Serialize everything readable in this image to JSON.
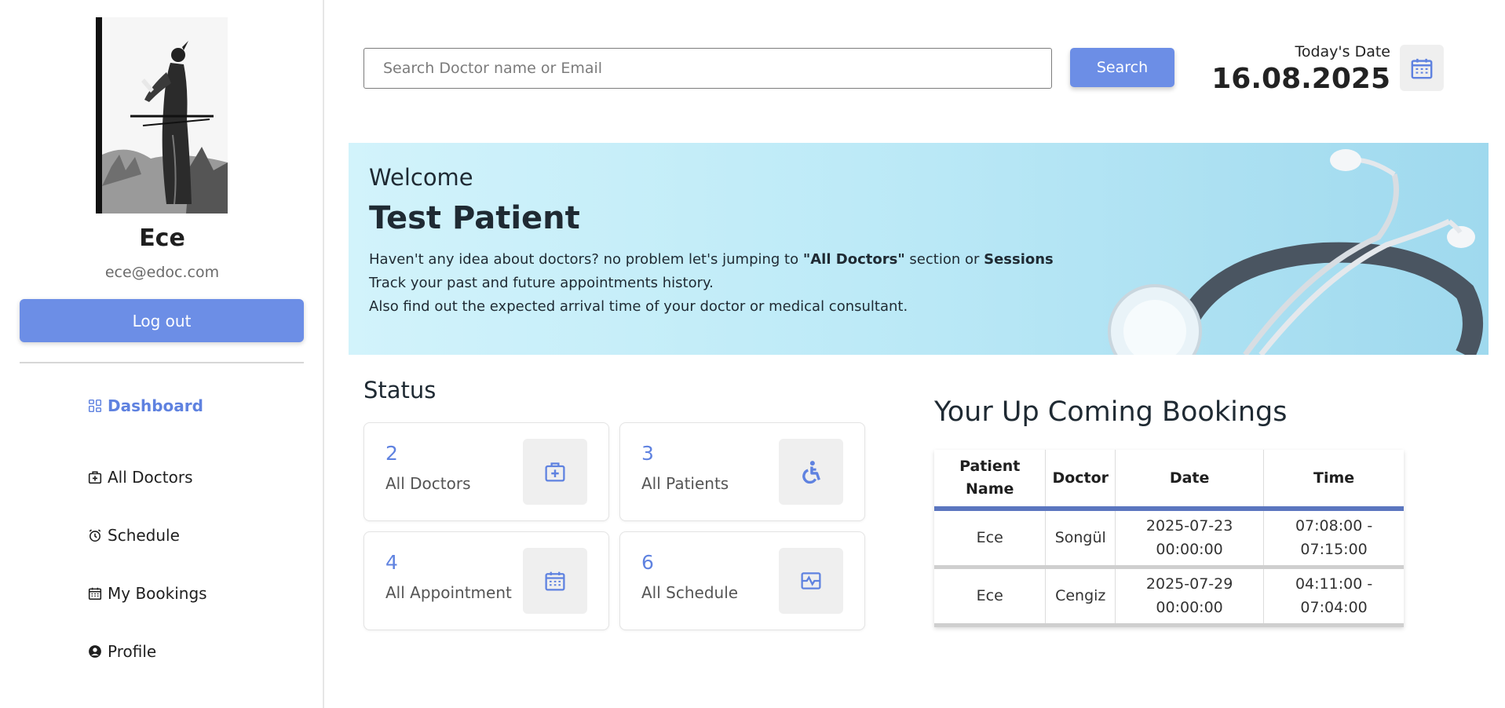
{
  "user": {
    "name": "Ece",
    "email": "ece@edoc.com",
    "logout_label": "Log out"
  },
  "nav": {
    "items": [
      {
        "label": "Dashboard",
        "icon": "dashboard-icon",
        "active": true
      },
      {
        "label": "All Doctors",
        "icon": "doctor-plus-icon"
      },
      {
        "label": "Schedule",
        "icon": "alarm-clock-icon"
      },
      {
        "label": "My Bookings",
        "icon": "calendar-icon"
      },
      {
        "label": "Profile",
        "icon": "user-circle-icon"
      }
    ]
  },
  "header": {
    "search_placeholder": "Search Doctor name or Email",
    "search_label": "Search",
    "date_label": "Today's Date",
    "date_value": "16.08.2025"
  },
  "welcome": {
    "label": "Welcome",
    "name": "Test Patient",
    "line1_prefix": "Haven't any idea about doctors? no problem let's jumping to ",
    "line1_bold1": "\"All Doctors\"",
    "line1_mid": " section or ",
    "line1_bold2": "Sessions",
    "line2": "Track your past and future appointments history.",
    "line3": "Also find out the expected arrival time of your doctor or medical consultant."
  },
  "status": {
    "title": "Status",
    "cards": [
      {
        "value": "2",
        "label": "All Doctors",
        "icon": "medical-case-icon"
      },
      {
        "value": "3",
        "label": "All Patients",
        "icon": "wheelchair-icon"
      },
      {
        "value": "4",
        "label": "All Appointment",
        "icon": "calendar-icon"
      },
      {
        "value": "6",
        "label": "All Schedule",
        "icon": "activity-icon"
      }
    ]
  },
  "bookings": {
    "title": "Your Up Coming Bookings",
    "headers": [
      "Patient Name",
      "Doctor",
      "Date",
      "Time"
    ],
    "rows": [
      [
        "Ece",
        "Songül",
        "2025-07-23 00:00:00",
        "07:08:00 - 07:15:00"
      ],
      [
        "Ece",
        "Cengiz",
        "2025-07-29 00:00:00",
        "04:11:00 - 07:04:00"
      ]
    ]
  },
  "colors": {
    "accent": "#6c8ee6",
    "active_nav": "#5f82e0",
    "table_header_rule": "#5b76bf"
  }
}
